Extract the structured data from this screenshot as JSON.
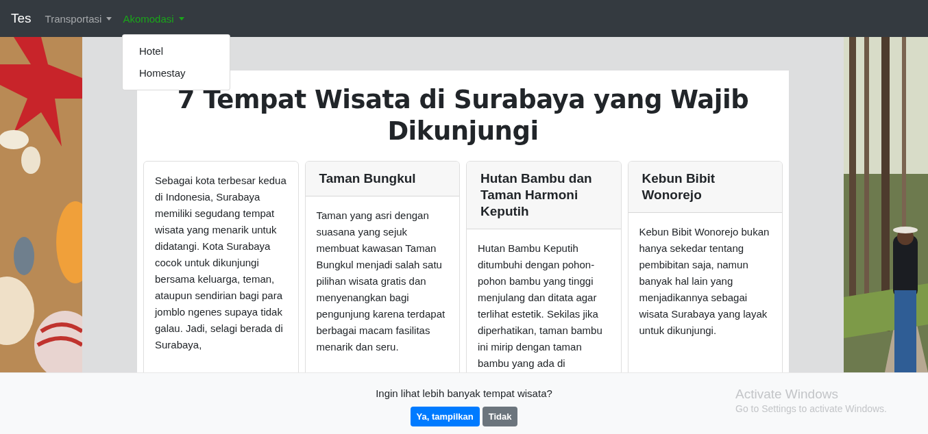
{
  "navbar": {
    "brand": "Tes",
    "items": [
      {
        "label": "Transportasi",
        "selected": false
      },
      {
        "label": "Akomodasi",
        "selected": true
      }
    ]
  },
  "dropdown": {
    "items": [
      "Hotel",
      "Homestay"
    ]
  },
  "page": {
    "title": "7 Tempat Wisata di Surabaya yang Wajib Dikunjungi",
    "cards": [
      {
        "kind": "intro",
        "body": "Sebagai kota terbesar kedua di Indonesia, Surabaya memiliki segudang tempat wisata yang menarik untuk didatangi. Kota Surabaya cocok untuk dikunjungi bersama keluarga, teman, ataupun sendirian bagi para jomblo ngenes supaya tidak galau. Jadi, selagi berada di Surabaya,"
      },
      {
        "kind": "place",
        "title": "Taman Bungkul",
        "body": "Taman yang asri dengan suasana yang sejuk membuat kawasan Taman Bungkul menjadi salah satu pilihan wisata gratis dan menyenangkan bagi pengunjung karena terdapat berbagai macam fasilitas menarik dan seru."
      },
      {
        "kind": "place",
        "title": "Hutan Bambu dan Taman Harmoni Keputih",
        "body": "Hutan Bambu Keputih ditumbuhi dengan pohon-pohon bambu yang tinggi menjulang dan ditata agar terlihat estetik. Sekilas jika diperhatikan, taman bambu ini mirip dengan taman bambu yang ada di"
      },
      {
        "kind": "place",
        "title": "Kebun Bibit Wonorejo",
        "body": "Kebun Bibit Wonorejo bukan hanya sekedar tentang pembibitan saja, namun banyak hal lain yang menjadikannya sebagai wisata Surabaya yang layak untuk dikunjungi."
      }
    ]
  },
  "bottom_bar": {
    "question": "Ingin lihat lebih banyak tempat wisata?",
    "buttons": [
      {
        "label": "Ya, tampilkan",
        "kind": "primary"
      },
      {
        "label": "Tidak",
        "kind": "secondary"
      }
    ]
  },
  "os_notice": {
    "title": "Activate Windows",
    "subtitle": "Go to Settings to activate Windows."
  }
}
